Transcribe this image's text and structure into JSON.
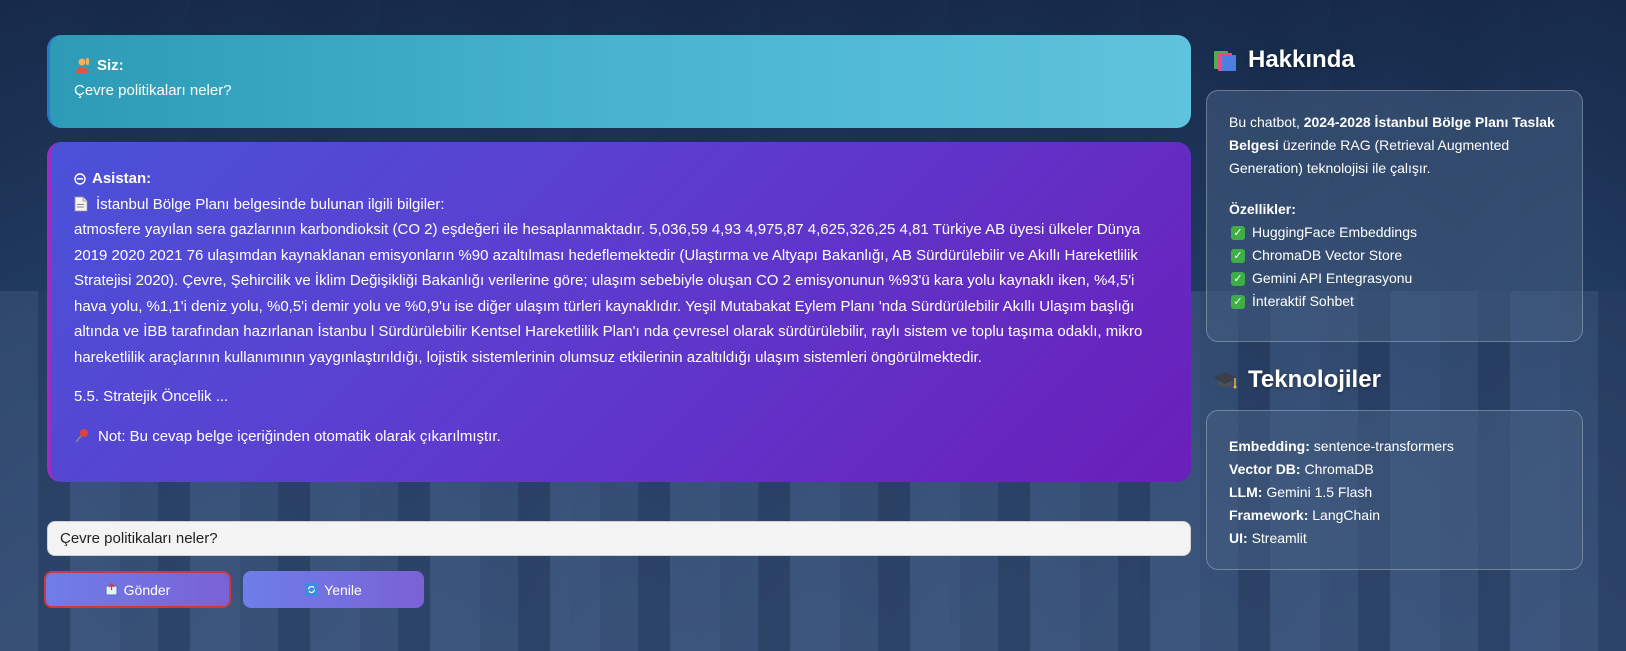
{
  "chat": {
    "user": {
      "label": "Siz:",
      "message": "Çevre politikaları neler?"
    },
    "assistant": {
      "label": "Asistan:",
      "intro": "İstanbul Bölge Planı belgesinde bulunan ilgili bilgiler:",
      "body": "atmosfere yayılan sera gazlarının karbondioksit (CO 2) eşdeğeri ile hesaplanmaktadır. 5,036,59 4,93 4,975,87 4,625,326,25 4,81 Türkiye AB üyesi ülkeler Dünya 2019 2020 2021 76 ulaşımdan kaynaklanan emisyonların %90 azaltılması hedeflemektedir (Ulaştırma ve Altyapı Bakanlığı, AB Sürdürülebilir ve Akıllı Hareketlilik Stratejisi 2020). Çevre, Şehircilik ve İklim Değişikliği Bakanlığı verilerine göre; ulaşım sebebiyle oluşan CO 2 emisyonunun %93'ü kara yolu kaynaklı iken, %4,5'i hava yolu, %1,1'i deniz yolu, %0,5'i demir yolu ve %0,9'u ise diğer ulaşım türleri kaynaklıdır. Yeşil Mutabakat Eylem Planı 'nda Sürdürülebilir Akıllı Ulaşım başlığı altında ve İBB tarafından hazırlanan İstanbu l Sürdürülebilir Kentsel Hareketlilik Plan'ı nda çevresel olarak sürdürülebilir, raylı sistem ve toplu taşıma odaklı, mikro hareketlilik araçlarının kullanımının yaygınlaştırıldığı, lojistik sistemlerinin olumsuz etkilerinin azaltıldığı ulaşım sistemleri öngörülmektedir.",
      "section": "5.5. Stratejik Öncelik ...",
      "note": "Not: Bu cevap belge içeriğinden otomatik olarak çıkarılmıştır."
    }
  },
  "input": {
    "value": "Çevre politikaları neler?"
  },
  "buttons": {
    "send": "Gönder",
    "refresh": "Yenile"
  },
  "sidebar": {
    "about": {
      "title": "Hakkında",
      "text_pre": "Bu chatbot, ",
      "text_bold": "2024-2028 İstanbul Bölge Planı Taslak Belgesi",
      "text_post": " üzerinde RAG (Retrieval Augmented Generation) teknolojisi ile çalışır.",
      "features_title": "Özellikler:",
      "features": [
        "HuggingFace Embeddings",
        "ChromaDB Vector Store",
        "Gemini API Entegrasyonu",
        "İnteraktif Sohbet"
      ]
    },
    "tech": {
      "title": "Teknolojiler",
      "rows": [
        {
          "key": "Embedding:",
          "value": "sentence-transformers"
        },
        {
          "key": "Vector DB:",
          "value": "ChromaDB"
        },
        {
          "key": "LLM:",
          "value": "Gemini 1.5 Flash"
        },
        {
          "key": "Framework:",
          "value": "LangChain"
        },
        {
          "key": "UI:",
          "value": "Streamlit"
        }
      ]
    }
  }
}
